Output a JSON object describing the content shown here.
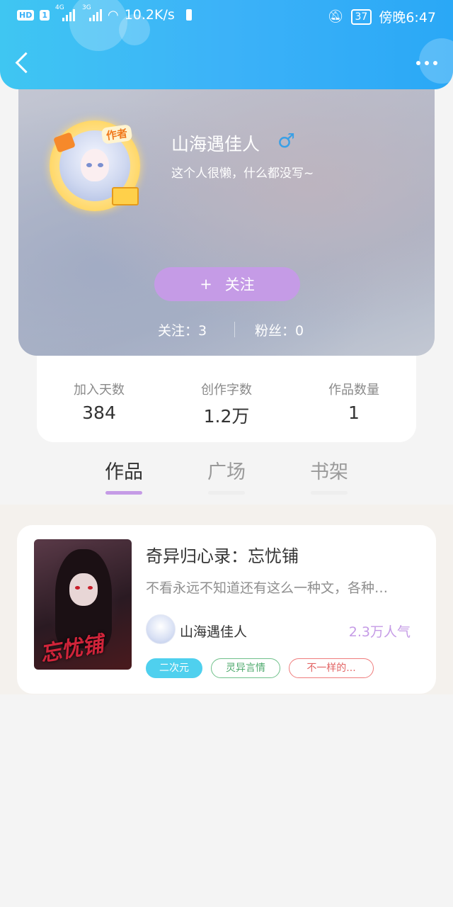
{
  "status_bar": {
    "hd": "HD",
    "sim": "1",
    "net1": "4G",
    "net2": "3G",
    "speed": "10.2K/s",
    "battery": "37",
    "time": "傍晚6:47"
  },
  "header": {
    "back_icon": "chevron-left-icon",
    "more_icon": "more-dots-icon"
  },
  "profile": {
    "author_badge": "作者",
    "username": "山海遇佳人",
    "gender_symbol": "♂",
    "bio": "这个人很懒，什么都没写~",
    "follow_plus": "+",
    "follow_label": "关注",
    "following_label": "关注：",
    "following_count": "3",
    "fans_label": "粉丝：",
    "fans_count": "0"
  },
  "stats": [
    {
      "label": "加入天数",
      "value": "384"
    },
    {
      "label": "创作字数",
      "value": "1.2万"
    },
    {
      "label": "作品数量",
      "value": "1"
    }
  ],
  "tabs": [
    {
      "label": "作品",
      "active": true
    },
    {
      "label": "广场",
      "active": false
    },
    {
      "label": "书架",
      "active": false
    }
  ],
  "book": {
    "cover_text": "忘忧铺",
    "title": "奇异归心录：忘忧铺",
    "description": "不看永远不知道还有这么一种文，各种…",
    "author": "山海遇佳人",
    "popularity": "2.3万人气",
    "tags": [
      "二次元",
      "灵异言情",
      "不一样的..."
    ]
  },
  "colors": {
    "header_blue": "#3cb2f8",
    "accent_purple": "#c59be6",
    "tag_cyan": "#4fd0ee",
    "tag_green": "#6fc08a",
    "tag_red": "#ef7c7c"
  }
}
